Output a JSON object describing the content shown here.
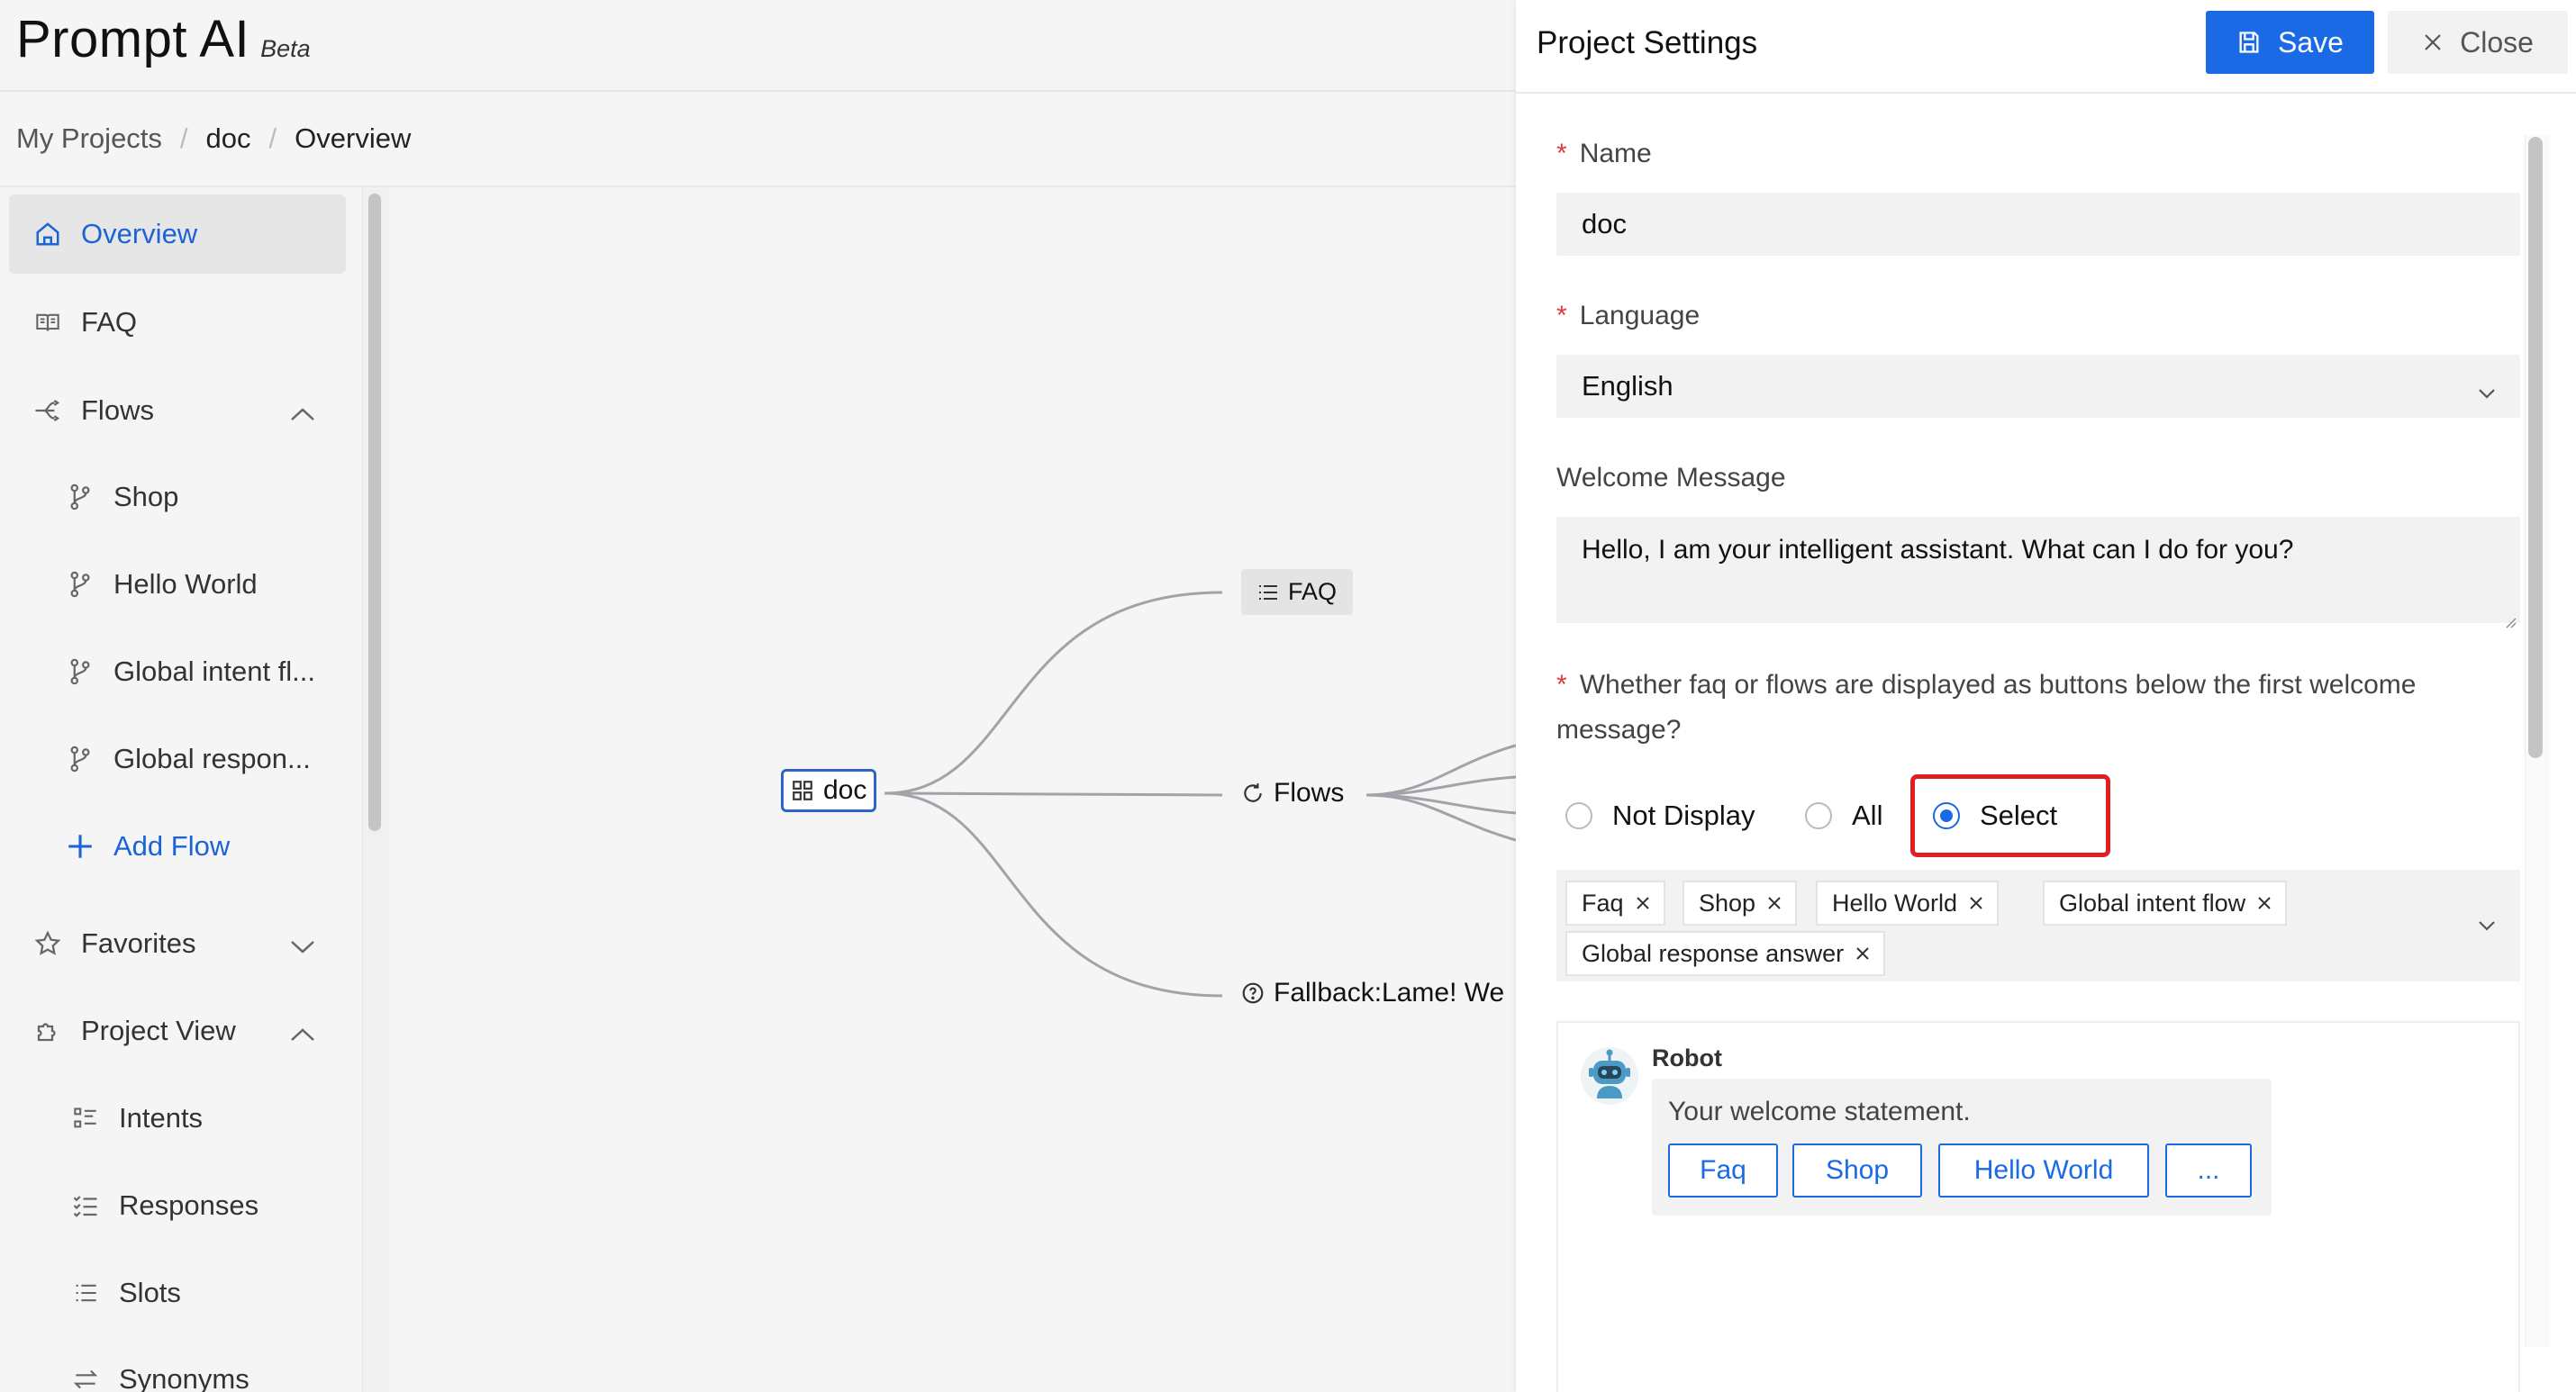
{
  "app": {
    "title": "Prompt AI",
    "beta_label": "Beta"
  },
  "breadcrumb": {
    "items": [
      "My Projects",
      "doc",
      "Overview"
    ],
    "separator": "/"
  },
  "sidebar": {
    "overview": "Overview",
    "faq": "FAQ",
    "flows": "Flows",
    "flow_items": [
      "Shop",
      "Hello World",
      "Global intent fl...",
      "Global respon..."
    ],
    "add_flow": "Add Flow",
    "favorites": "Favorites",
    "project_view": "Project View",
    "project_items": [
      "Intents",
      "Responses",
      "Slots",
      "Synonyms"
    ]
  },
  "mindmap": {
    "root": "doc",
    "faq": "FAQ",
    "flows": "Flows",
    "fallback": "Fallback:Lame! We"
  },
  "drawer": {
    "title": "Project Settings",
    "save_label": "Save",
    "close_label": "Close",
    "name_label": "Name",
    "name_value": "doc",
    "language_label": "Language",
    "language_value": "English",
    "welcome_label": "Welcome Message",
    "welcome_value": "Hello, I am your intelligent assistant. What can I do for you?",
    "display_question": "Whether faq or flows are displayed as buttons below the first welcome message?",
    "radio_options": [
      "Not Display",
      "All",
      "Select"
    ],
    "radio_selected": "Select",
    "selected_tags": [
      "Faq",
      "Shop",
      "Hello World",
      "Global intent flow",
      "Global response answer"
    ],
    "preview": {
      "bot_name": "Robot",
      "statement": "Your welcome statement.",
      "buttons": [
        "Faq",
        "Shop",
        "Hello World",
        "..."
      ]
    }
  },
  "colors": {
    "accent": "#1a6ae6",
    "required": "#e03b3b",
    "highlight": "#e02020"
  }
}
